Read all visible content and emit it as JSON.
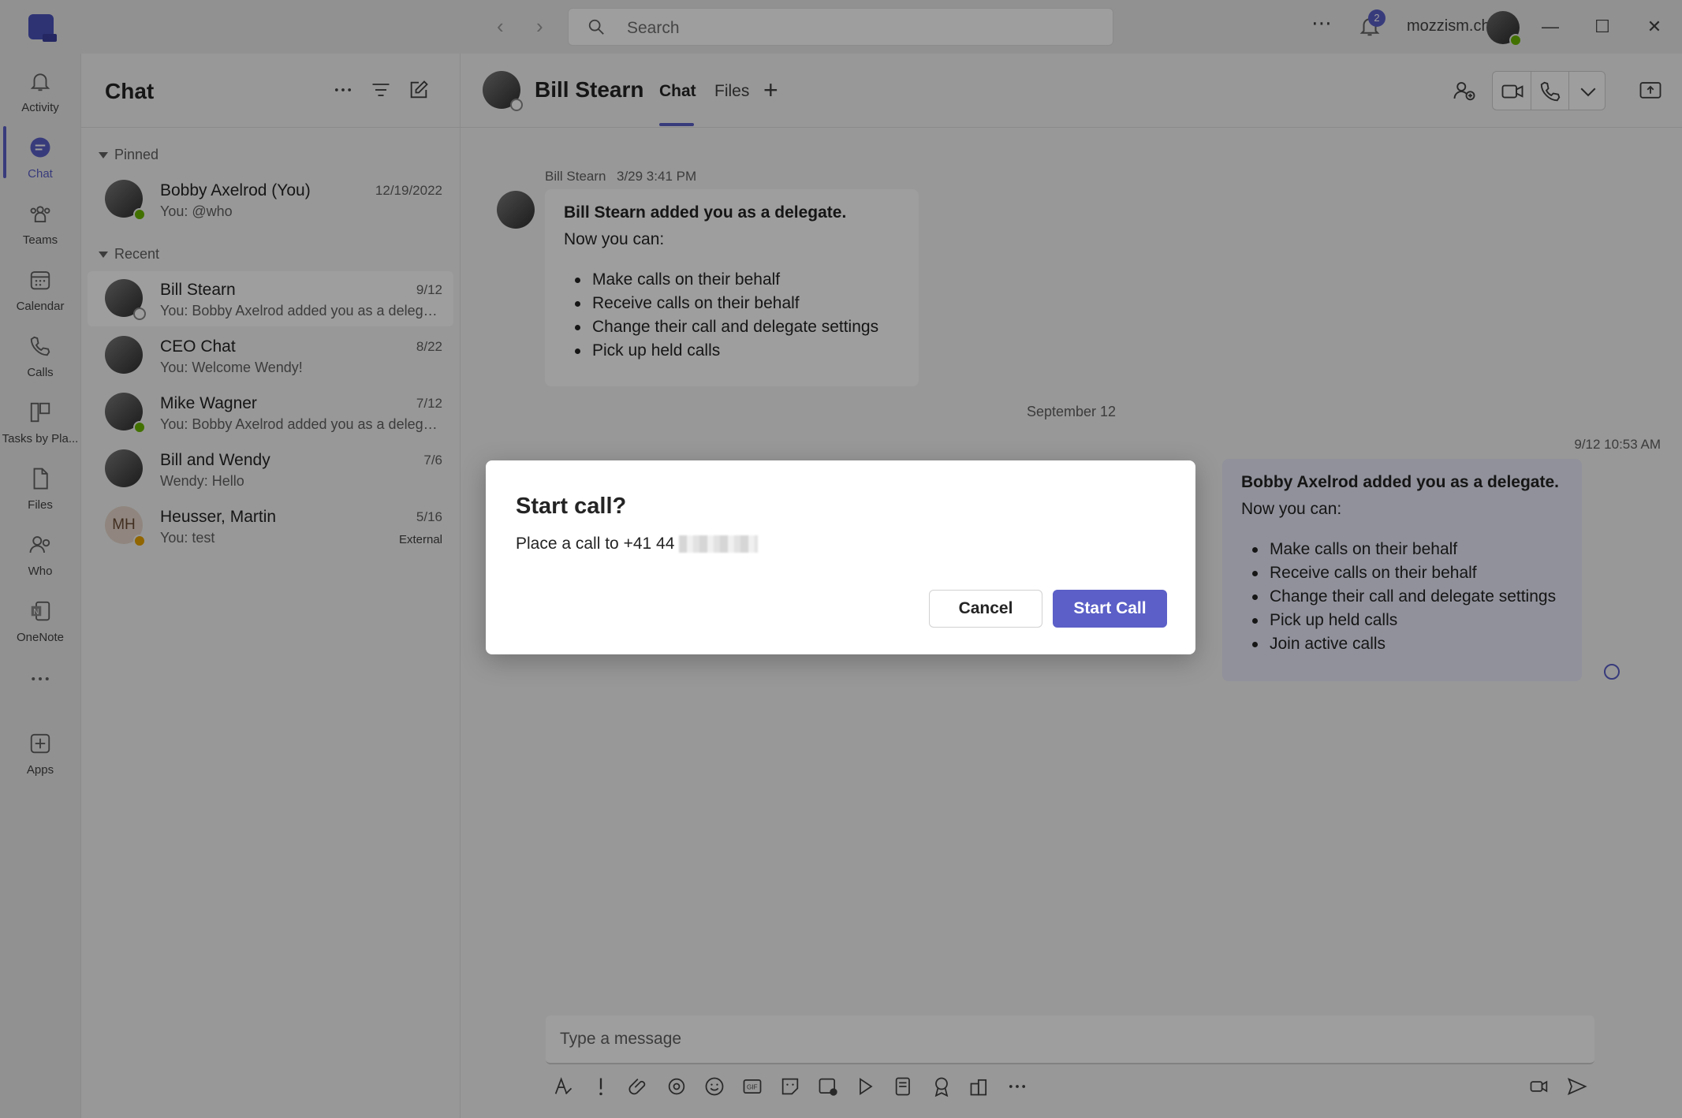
{
  "titlebar": {
    "search_placeholder": "Search",
    "notification_count": "2",
    "org_name": "mozzism.ch"
  },
  "rail": {
    "items": [
      {
        "label": "Activity",
        "icon": "bell-icon"
      },
      {
        "label": "Chat",
        "icon": "chat-icon"
      },
      {
        "label": "Teams",
        "icon": "teams-icon"
      },
      {
        "label": "Calendar",
        "icon": "calendar-icon"
      },
      {
        "label": "Calls",
        "icon": "phone-icon"
      },
      {
        "label": "Tasks by Pla...",
        "icon": "tasks-icon"
      },
      {
        "label": "Files",
        "icon": "file-icon"
      },
      {
        "label": "Who",
        "icon": "who-icon"
      },
      {
        "label": "OneNote",
        "icon": "onenote-icon"
      },
      {
        "label": "Apps",
        "icon": "add-apps-icon"
      }
    ]
  },
  "chatlist": {
    "title": "Chat",
    "pinned_label": "Pinned",
    "recent_label": "Recent",
    "pinned": [
      {
        "name": "Bobby Axelrod (You)",
        "date": "12/19/2022",
        "preview": "You: @who"
      }
    ],
    "recent": [
      {
        "name": "Bill Stearn",
        "date": "9/12",
        "preview": "You: Bobby Axelrod added you as a delega..."
      },
      {
        "name": "CEO Chat",
        "date": "8/22",
        "preview": "You: Welcome Wendy!"
      },
      {
        "name": "Mike Wagner",
        "date": "7/12",
        "preview": "You: Bobby Axelrod added you as a delega..."
      },
      {
        "name": "Bill and Wendy",
        "date": "7/6",
        "preview": "Wendy: Hello"
      },
      {
        "name": "Heusser, Martin",
        "date": "5/16",
        "preview": "You: test",
        "initials": "MH",
        "badge": "External"
      }
    ]
  },
  "conversation": {
    "contact_name": "Bill Stearn",
    "tabs": [
      "Chat",
      "Files"
    ],
    "message1": {
      "sender": "Bill Stearn",
      "time": "3/29 3:41 PM",
      "title": "Bill Stearn added you as a delegate.",
      "intro": "Now you can:",
      "items": [
        "Make calls on their behalf",
        "Receive calls on their behalf",
        "Change their call and delegate settings",
        "Pick up held calls"
      ]
    },
    "date_separator": "September 12",
    "message2": {
      "time": "9/12 10:53 AM",
      "title": "Bobby Axelrod added you as a delegate.",
      "intro": "Now you can:",
      "items": [
        "Make calls on their behalf",
        "Receive calls on their behalf",
        "Change their call and delegate settings",
        "Pick up held calls",
        "Join active calls"
      ]
    },
    "compose_placeholder": "Type a message"
  },
  "dialog": {
    "title": "Start call?",
    "body_prefix": "Place a call to +41 44",
    "cancel_label": "Cancel",
    "start_label": "Start Call"
  },
  "colors": {
    "accent": "#5b5fc7",
    "presence_available": "#6bb700",
    "presence_away": "#eaa300"
  }
}
